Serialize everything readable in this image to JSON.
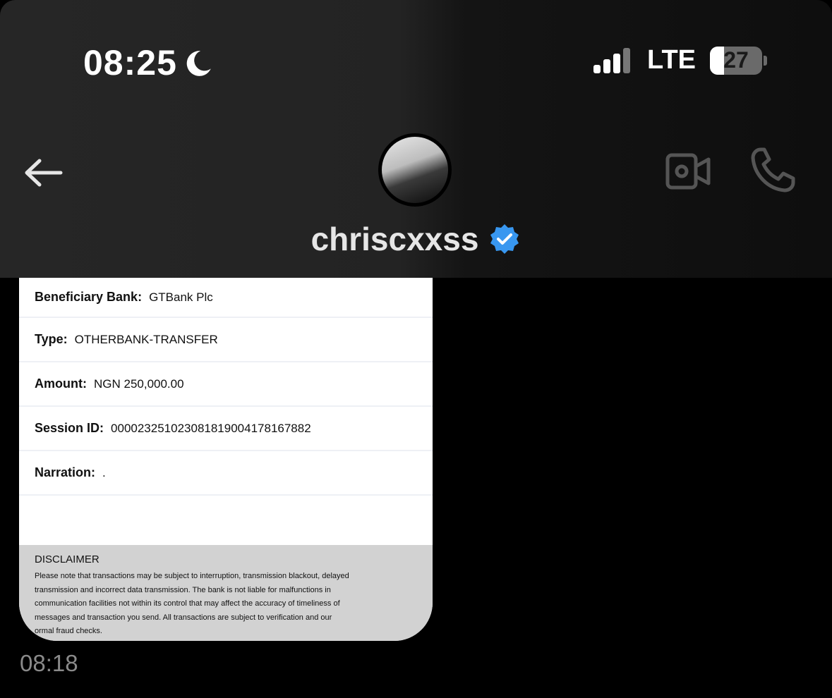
{
  "status_bar": {
    "time": "08:25",
    "network": "LTE",
    "battery_level": "27",
    "battery_fraction": 0.27
  },
  "header": {
    "username": "chriscxxss",
    "verified": true,
    "icons": [
      "back-arrow-icon",
      "video-call-icon",
      "phone-call-icon",
      "verified-badge-icon",
      "moon-icon"
    ]
  },
  "receipt": {
    "rows": [
      {
        "label": "Beneficiary Bank:",
        "value": "GTBank Plc"
      },
      {
        "label": "Type:",
        "value": "OTHERBANK-TRANSFER"
      },
      {
        "label": "Amount:",
        "value": "NGN 250,000.00"
      },
      {
        "label": "Session ID:",
        "value": "000023251023081819004178167882"
      },
      {
        "label": "Narration:",
        "value": "."
      }
    ],
    "disclaimer_title": "DISCLAIMER",
    "disclaimer_lines": [
      "Please note that transactions may be subject to interruption, transmission blackout, delayed",
      "transmission and incorrect data transmission. The bank is not liable for malfunctions in",
      "communication facilities not within its control that may affect the accuracy of timeliness of",
      "messages and transaction you send. All transactions are subject to verification and our",
      "ormal fraud checks."
    ]
  },
  "message": {
    "time": "08:18"
  },
  "colors": {
    "verified_blue": "#3897f0",
    "header_bg": "#232323",
    "timestamp": "#8a8a8a"
  }
}
